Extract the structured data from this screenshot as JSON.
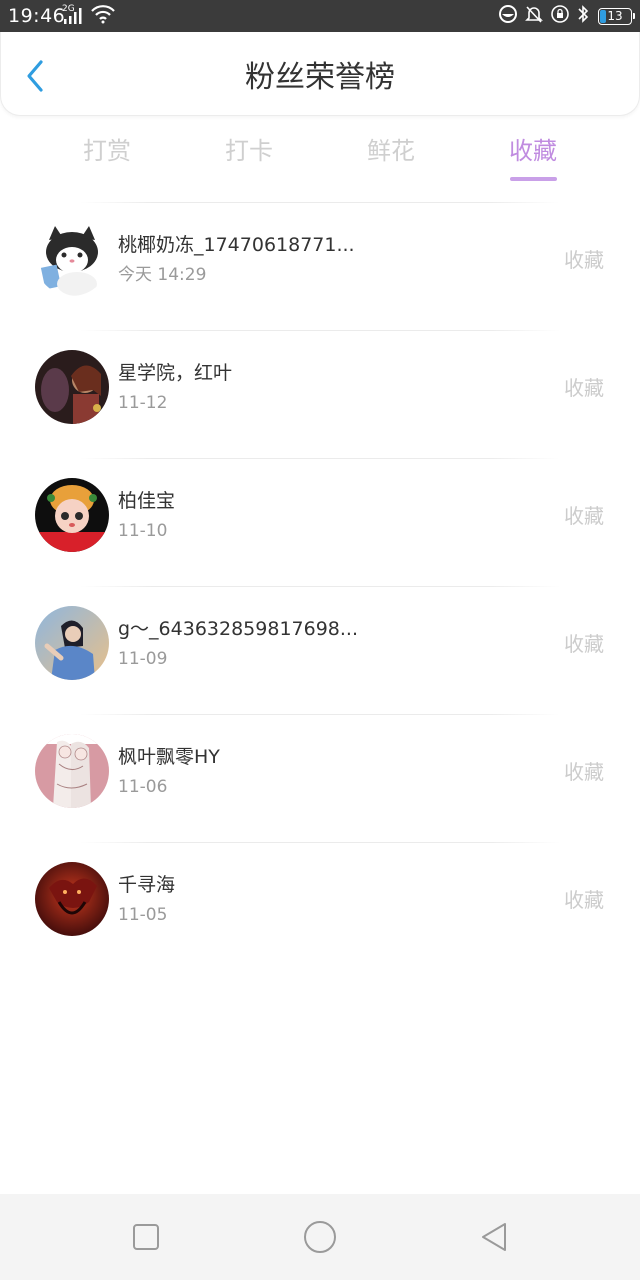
{
  "status_bar": {
    "time": "19:46",
    "network_type": "2G",
    "battery_level": "13",
    "icons": [
      "signal-icon",
      "wifi-icon",
      "ring-icon",
      "bell-mute-icon",
      "lock-rotation-icon",
      "bluetooth-icon",
      "battery-icon"
    ]
  },
  "header": {
    "title": "粉丝荣誉榜",
    "back_icon": "chevron-left-icon",
    "accent_color": "#2f9de0"
  },
  "tabs": [
    {
      "label": "打赏",
      "active": false
    },
    {
      "label": "打卡",
      "active": false
    },
    {
      "label": "鲜花",
      "active": false
    },
    {
      "label": "收藏",
      "active": true
    }
  ],
  "tab_active_color": "#c08ce0",
  "list": [
    {
      "name": "桃椰奶冻_17470618771...",
      "date": "今天 14:29",
      "action": "收藏"
    },
    {
      "name": "星学院，红叶",
      "date": "11-12",
      "action": "收藏"
    },
    {
      "name": "柏佳宝",
      "date": "11-10",
      "action": "收藏"
    },
    {
      "name": "g〜_643632859817698...",
      "date": "11-09",
      "action": "收藏"
    },
    {
      "name": "枫叶飘零HY",
      "date": "11-06",
      "action": "收藏"
    },
    {
      "name": "千寻海",
      "date": "11-05",
      "action": "收藏"
    }
  ],
  "nav_bar": {
    "icons": [
      "recent-apps-icon",
      "home-icon",
      "back-triangle-icon"
    ]
  }
}
